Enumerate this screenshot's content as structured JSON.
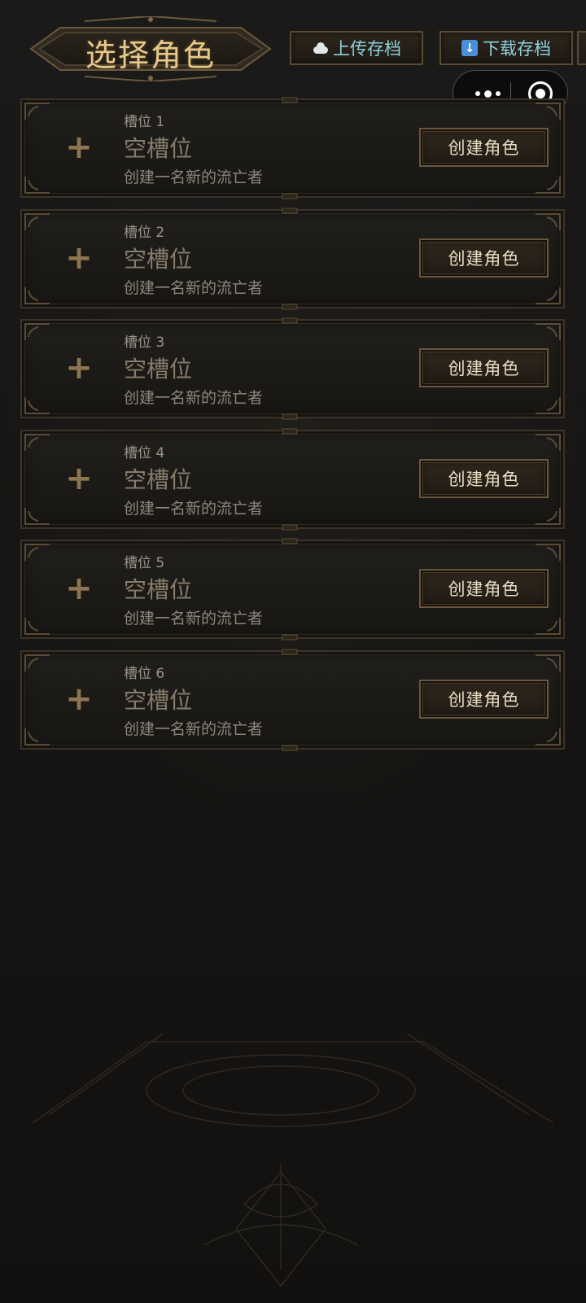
{
  "header": {
    "title": "选择角色",
    "upload_label": "上传存档",
    "download_label": "下载存档",
    "upload_icon": "cloud-icon",
    "download_icon": "download-icon"
  },
  "capsule": {
    "more_icon": "more-icon",
    "close_icon": "target-icon"
  },
  "slots": [
    {
      "label": "槽位 1",
      "title": "空槽位",
      "desc": "创建一名新的流亡者",
      "button": "创建角色"
    },
    {
      "label": "槽位 2",
      "title": "空槽位",
      "desc": "创建一名新的流亡者",
      "button": "创建角色"
    },
    {
      "label": "槽位 3",
      "title": "空槽位",
      "desc": "创建一名新的流亡者",
      "button": "创建角色"
    },
    {
      "label": "槽位 4",
      "title": "空槽位",
      "desc": "创建一名新的流亡者",
      "button": "创建角色"
    },
    {
      "label": "槽位 5",
      "title": "空槽位",
      "desc": "创建一名新的流亡者",
      "button": "创建角色"
    },
    {
      "label": "槽位 6",
      "title": "空槽位",
      "desc": "创建一名新的流亡者",
      "button": "创建角色"
    }
  ],
  "colors": {
    "title_gold": "#e7c98d",
    "button_text_cyan": "#8fd0dc",
    "frame_bronze": "#5a4a33",
    "background": "#171614"
  }
}
